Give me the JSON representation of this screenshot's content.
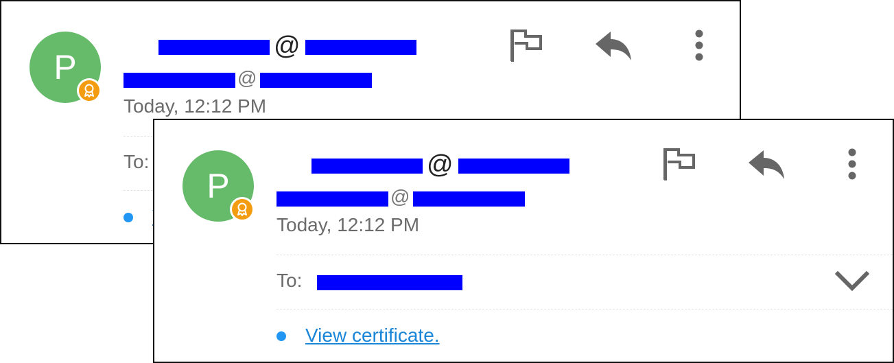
{
  "sender": {
    "avatar_initial": "P",
    "at_symbol": "@",
    "timestamp": "Today, 12:12 PM"
  },
  "recipients": {
    "to_label": "To:"
  },
  "certificate": {
    "link_label": "View certificate."
  },
  "actions": {
    "flag_icon": "flag-icon",
    "reply_icon": "reply-icon",
    "more_icon": "more-vert-icon",
    "expand_icon": "chevron-down-icon"
  },
  "colors": {
    "avatar": "#66bb6a",
    "badge": "#f39c12",
    "redaction": "#0000ff",
    "link": "#1a86d8",
    "bullet": "#2196f3",
    "icon": "#666666"
  }
}
